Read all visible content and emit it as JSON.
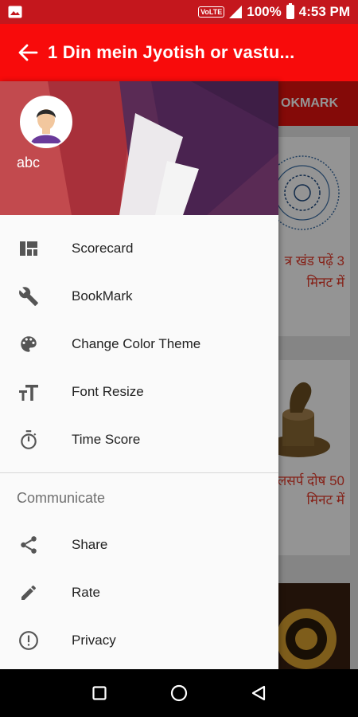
{
  "status_bar": {
    "volte": "VoLTE",
    "battery": "100%",
    "time": "4:53 PM"
  },
  "app_bar": {
    "title": "1 Din mein Jyotish or vastu...",
    "back_icon": "arrow-back-icon"
  },
  "background": {
    "tab_label": "OKMARK",
    "card1_text": "त्र खंड पढ़ें 3 मिनट में",
    "card2_text": "लसर्प दोष 50 मिनट में"
  },
  "drawer": {
    "user_name": "abc",
    "items": [
      {
        "label": "Scorecard",
        "icon": "dashboard-icon"
      },
      {
        "label": "BookMark",
        "icon": "wrench-icon"
      },
      {
        "label": "Change Color Theme",
        "icon": "palette-icon"
      },
      {
        "label": "Font Resize",
        "icon": "text-fields-icon"
      },
      {
        "label": "Time Score",
        "icon": "timer-icon"
      }
    ],
    "section_title": "Communicate",
    "comm_items": [
      {
        "label": "Share",
        "icon": "share-icon"
      },
      {
        "label": "Rate",
        "icon": "pencil-icon"
      },
      {
        "label": "Privacy",
        "icon": "info-circle-icon"
      }
    ]
  },
  "colors": {
    "app_bar": "#f80b0b",
    "status_bar": "#c4171d",
    "drawer_bg": "#fafafa"
  }
}
